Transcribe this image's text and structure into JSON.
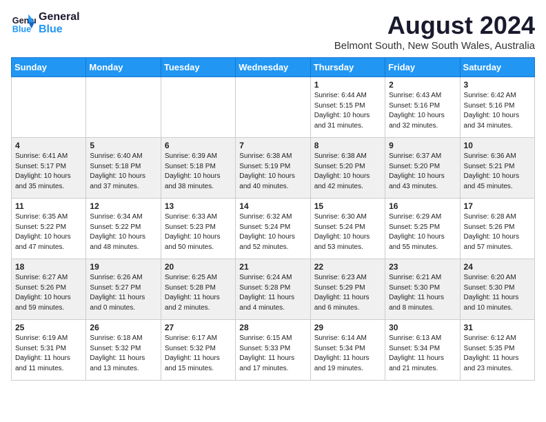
{
  "header": {
    "logo_line1": "General",
    "logo_line2": "Blue",
    "title": "August 2024",
    "subtitle": "Belmont South, New South Wales, Australia"
  },
  "weekdays": [
    "Sunday",
    "Monday",
    "Tuesday",
    "Wednesday",
    "Thursday",
    "Friday",
    "Saturday"
  ],
  "weeks": [
    [
      {
        "day": "",
        "info": ""
      },
      {
        "day": "",
        "info": ""
      },
      {
        "day": "",
        "info": ""
      },
      {
        "day": "",
        "info": ""
      },
      {
        "day": "1",
        "info": "Sunrise: 6:44 AM\nSunset: 5:15 PM\nDaylight: 10 hours\nand 31 minutes."
      },
      {
        "day": "2",
        "info": "Sunrise: 6:43 AM\nSunset: 5:16 PM\nDaylight: 10 hours\nand 32 minutes."
      },
      {
        "day": "3",
        "info": "Sunrise: 6:42 AM\nSunset: 5:16 PM\nDaylight: 10 hours\nand 34 minutes."
      }
    ],
    [
      {
        "day": "4",
        "info": "Sunrise: 6:41 AM\nSunset: 5:17 PM\nDaylight: 10 hours\nand 35 minutes."
      },
      {
        "day": "5",
        "info": "Sunrise: 6:40 AM\nSunset: 5:18 PM\nDaylight: 10 hours\nand 37 minutes."
      },
      {
        "day": "6",
        "info": "Sunrise: 6:39 AM\nSunset: 5:18 PM\nDaylight: 10 hours\nand 38 minutes."
      },
      {
        "day": "7",
        "info": "Sunrise: 6:38 AM\nSunset: 5:19 PM\nDaylight: 10 hours\nand 40 minutes."
      },
      {
        "day": "8",
        "info": "Sunrise: 6:38 AM\nSunset: 5:20 PM\nDaylight: 10 hours\nand 42 minutes."
      },
      {
        "day": "9",
        "info": "Sunrise: 6:37 AM\nSunset: 5:20 PM\nDaylight: 10 hours\nand 43 minutes."
      },
      {
        "day": "10",
        "info": "Sunrise: 6:36 AM\nSunset: 5:21 PM\nDaylight: 10 hours\nand 45 minutes."
      }
    ],
    [
      {
        "day": "11",
        "info": "Sunrise: 6:35 AM\nSunset: 5:22 PM\nDaylight: 10 hours\nand 47 minutes."
      },
      {
        "day": "12",
        "info": "Sunrise: 6:34 AM\nSunset: 5:22 PM\nDaylight: 10 hours\nand 48 minutes."
      },
      {
        "day": "13",
        "info": "Sunrise: 6:33 AM\nSunset: 5:23 PM\nDaylight: 10 hours\nand 50 minutes."
      },
      {
        "day": "14",
        "info": "Sunrise: 6:32 AM\nSunset: 5:24 PM\nDaylight: 10 hours\nand 52 minutes."
      },
      {
        "day": "15",
        "info": "Sunrise: 6:30 AM\nSunset: 5:24 PM\nDaylight: 10 hours\nand 53 minutes."
      },
      {
        "day": "16",
        "info": "Sunrise: 6:29 AM\nSunset: 5:25 PM\nDaylight: 10 hours\nand 55 minutes."
      },
      {
        "day": "17",
        "info": "Sunrise: 6:28 AM\nSunset: 5:26 PM\nDaylight: 10 hours\nand 57 minutes."
      }
    ],
    [
      {
        "day": "18",
        "info": "Sunrise: 6:27 AM\nSunset: 5:26 PM\nDaylight: 10 hours\nand 59 minutes."
      },
      {
        "day": "19",
        "info": "Sunrise: 6:26 AM\nSunset: 5:27 PM\nDaylight: 11 hours\nand 0 minutes."
      },
      {
        "day": "20",
        "info": "Sunrise: 6:25 AM\nSunset: 5:28 PM\nDaylight: 11 hours\nand 2 minutes."
      },
      {
        "day": "21",
        "info": "Sunrise: 6:24 AM\nSunset: 5:28 PM\nDaylight: 11 hours\nand 4 minutes."
      },
      {
        "day": "22",
        "info": "Sunrise: 6:23 AM\nSunset: 5:29 PM\nDaylight: 11 hours\nand 6 minutes."
      },
      {
        "day": "23",
        "info": "Sunrise: 6:21 AM\nSunset: 5:30 PM\nDaylight: 11 hours\nand 8 minutes."
      },
      {
        "day": "24",
        "info": "Sunrise: 6:20 AM\nSunset: 5:30 PM\nDaylight: 11 hours\nand 10 minutes."
      }
    ],
    [
      {
        "day": "25",
        "info": "Sunrise: 6:19 AM\nSunset: 5:31 PM\nDaylight: 11 hours\nand 11 minutes."
      },
      {
        "day": "26",
        "info": "Sunrise: 6:18 AM\nSunset: 5:32 PM\nDaylight: 11 hours\nand 13 minutes."
      },
      {
        "day": "27",
        "info": "Sunrise: 6:17 AM\nSunset: 5:32 PM\nDaylight: 11 hours\nand 15 minutes."
      },
      {
        "day": "28",
        "info": "Sunrise: 6:15 AM\nSunset: 5:33 PM\nDaylight: 11 hours\nand 17 minutes."
      },
      {
        "day": "29",
        "info": "Sunrise: 6:14 AM\nSunset: 5:34 PM\nDaylight: 11 hours\nand 19 minutes."
      },
      {
        "day": "30",
        "info": "Sunrise: 6:13 AM\nSunset: 5:34 PM\nDaylight: 11 hours\nand 21 minutes."
      },
      {
        "day": "31",
        "info": "Sunrise: 6:12 AM\nSunset: 5:35 PM\nDaylight: 11 hours\nand 23 minutes."
      }
    ]
  ]
}
